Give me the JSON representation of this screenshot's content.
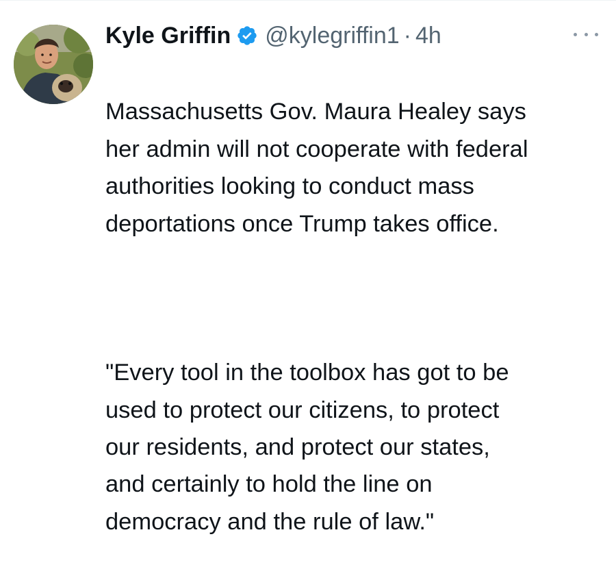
{
  "tweet": {
    "author_name": "Kyle Griffin",
    "handle": "@kylegriffin1",
    "separator": "·",
    "time_ago": "4h",
    "verified_icon": "verified-badge-icon",
    "more_icon": "more-options-icon",
    "paragraph_1": "Massachusetts Gov. Maura Healey says\nher admin will not cooperate with federal\nauthorities looking to conduct mass\ndeportations once Trump takes office.",
    "paragraph_2": "\"Every tool in the toolbox has got to be\nused to protect our citizens, to protect\nour residents, and protect our states,\nand certainly to hold the line on\ndemocracy and the rule of law.\""
  },
  "colors": {
    "text_primary": "#0f1419",
    "text_secondary": "#536471",
    "verified_blue": "#1d9bf0",
    "background": "#ffffff"
  }
}
